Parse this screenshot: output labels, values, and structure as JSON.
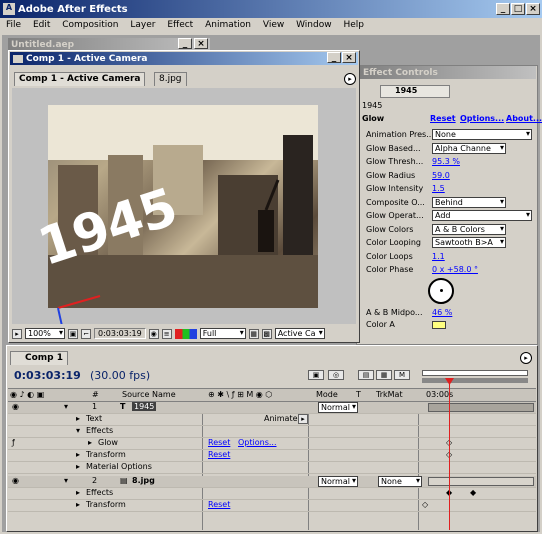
{
  "app": {
    "title": "Adobe After Effects"
  },
  "menu": [
    "File",
    "Edit",
    "Composition",
    "Layer",
    "Effect",
    "Animation",
    "View",
    "Window",
    "Help"
  ],
  "bg_window": {
    "title": "Untitled.aep"
  },
  "comp_window": {
    "title": "Comp 1 - Active Camera",
    "tab1": "Comp 1 - Active Camera",
    "tab2": "8.jpg",
    "image_text": "1945",
    "zoom": "100%",
    "timecode": "0:03:03:19",
    "resolution": "Full",
    "view": "Active Ca"
  },
  "effect_controls": {
    "title": "Effect Controls",
    "layer": "1945",
    "effect": "Glow",
    "reset": "Reset",
    "options": "Options...",
    "about": "About...",
    "rows": [
      {
        "label": "Animation Pres...",
        "value": "None",
        "type": "dd"
      },
      {
        "label": "Glow Based...",
        "value": "Alpha Channe",
        "type": "dd"
      },
      {
        "label": "Glow Thresh...",
        "value": "95.3 %",
        "type": "val"
      },
      {
        "label": "Glow Radius",
        "value": "59.0",
        "type": "val"
      },
      {
        "label": "Glow Intensity",
        "value": "1.5",
        "type": "val"
      },
      {
        "label": "Composite O...",
        "value": "Behind",
        "type": "dd"
      },
      {
        "label": "Glow Operat...",
        "value": "Add",
        "type": "dd"
      },
      {
        "label": "Glow Colors",
        "value": "A & B Colors",
        "type": "dd"
      },
      {
        "label": "Color Looping",
        "value": "Sawtooth B>A",
        "type": "dd"
      },
      {
        "label": "Color Loops",
        "value": "1.1",
        "type": "val"
      },
      {
        "label": "Color Phase",
        "value": "0 x +58.0 °",
        "type": "val"
      }
    ],
    "ab_label": "A & B Midpo...",
    "ab_value": "46 %",
    "color_a": "Color A"
  },
  "timeline": {
    "tab": "Comp 1",
    "timecode": "0:03:03:19",
    "fps": "(30.00 fps)",
    "source_name": "Source Name",
    "hash": "#",
    "mode": "Mode",
    "t": "T",
    "trkmat": "TrkMat",
    "time": "03:00s",
    "animate": "Animate:",
    "layer1": {
      "num": "1",
      "name": "1945",
      "mode": "Normal"
    },
    "text": "Text",
    "effects": "Effects",
    "glow": "Glow",
    "reset": "Reset",
    "options": "Options...",
    "transform": "Transform",
    "material": "Material Options",
    "layer2": {
      "num": "2",
      "name": "8.jpg",
      "mode": "Normal",
      "trkmat": "None"
    }
  },
  "colors": {
    "accent": "#0a246a",
    "link": "#0000ff",
    "panel": "#d4d0c8"
  }
}
